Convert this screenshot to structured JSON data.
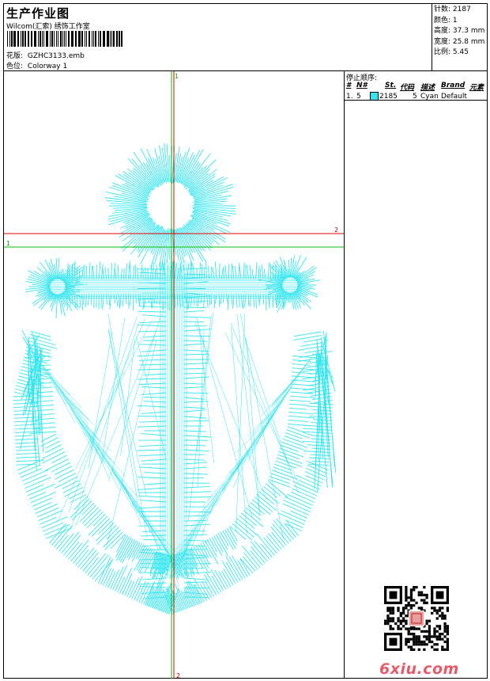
{
  "header": {
    "title": "生产作业图",
    "company": "Wilcom(汇索) 绣饰工作室",
    "design_label": "花版:",
    "design_value": "GZHC3133.emb",
    "colorway_label": "色位:",
    "colorway_value": "Colorway 1"
  },
  "stats": [
    {
      "label": "针数:",
      "value": "2187"
    },
    {
      "label": "颜色:",
      "value": "1"
    },
    {
      "label": "高度:",
      "value": "37.3 mm"
    },
    {
      "label": "宽度:",
      "value": "25.8 mm"
    },
    {
      "label": "比例:",
      "value": "5.45"
    }
  ],
  "guides": {
    "top_marker": "1",
    "left_marker": "1",
    "right_marker": "2",
    "bottom_marker": "2"
  },
  "stop_sequence": {
    "title": "停止顺序:",
    "columns": [
      "#",
      "N#",
      "St.",
      "代码",
      "描述",
      "Brand",
      "元素"
    ],
    "rows": [
      {
        "index": "1.",
        "needle": "5",
        "color": "#33e6ee",
        "stitches": "2185",
        "code": "5",
        "description": "Cyan",
        "brand": "Default",
        "element": ""
      }
    ]
  },
  "colors": {
    "thread": "#33e6ee",
    "guide_red": "#e00000",
    "guide_green": "#00c000"
  },
  "watermark": "6xiu.com"
}
